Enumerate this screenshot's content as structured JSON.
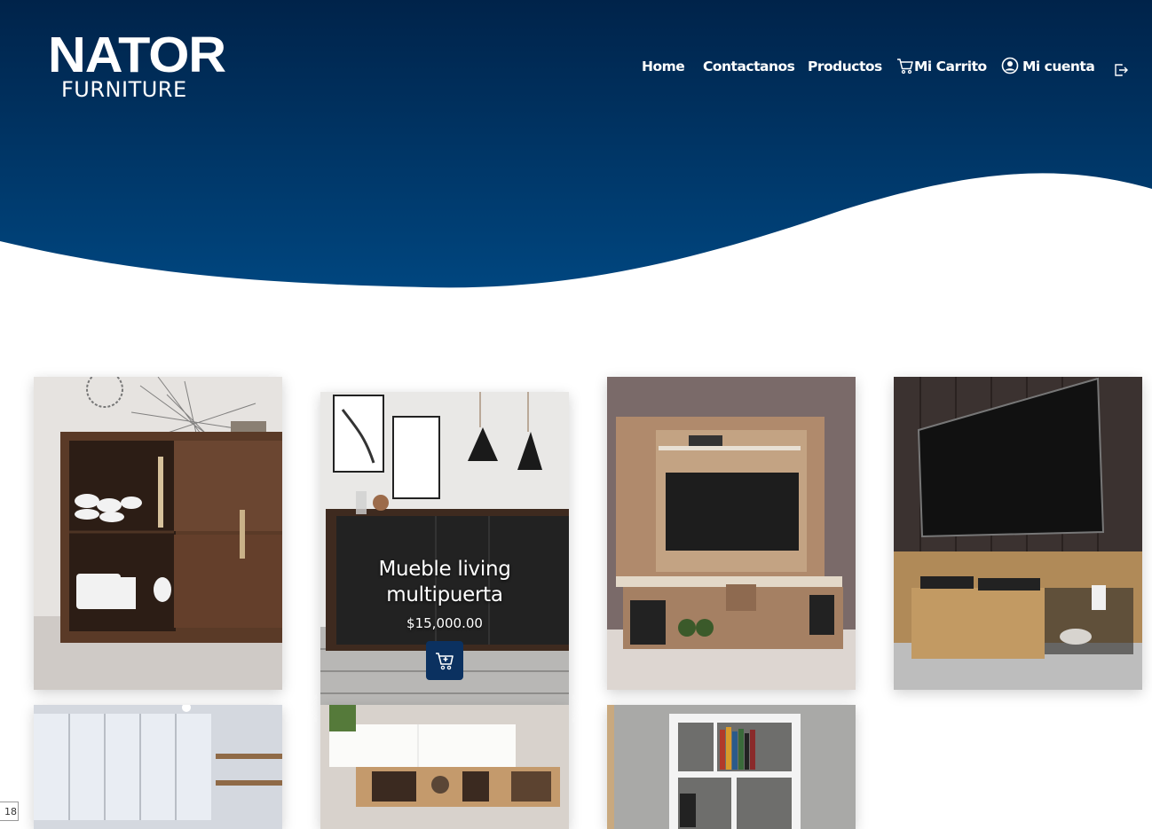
{
  "brand": {
    "name": "NATOR",
    "tagline": "FURNITURE"
  },
  "colors": {
    "navy_top": "#00234a",
    "navy_bottom": "#00467f",
    "button": "#0b3160"
  },
  "nav": {
    "home": "Home",
    "contact": "Contactanos",
    "products": "Productos",
    "cart": "Mi Carrito",
    "account": "Mi cuenta",
    "cart_icon": "shopping-cart-icon",
    "account_icon": "user-circle-icon",
    "logout_icon": "logout-icon"
  },
  "products": [
    {
      "image": "sideboard-dark-wood"
    },
    {
      "image": "black-sideboard-living",
      "title": "Mueble living multipuerta",
      "price": "$15,000.00",
      "action_icon": "add-to-cart-icon"
    },
    {
      "image": "tv-wall-unit-light-wood"
    },
    {
      "image": "tv-stand-oak-dark-wall"
    },
    {
      "image": "white-kitchen-cabinets"
    },
    {
      "image": "white-wall-shelf-unit"
    },
    {
      "image": "white-bookshelf"
    }
  ],
  "page_indicator": "18"
}
